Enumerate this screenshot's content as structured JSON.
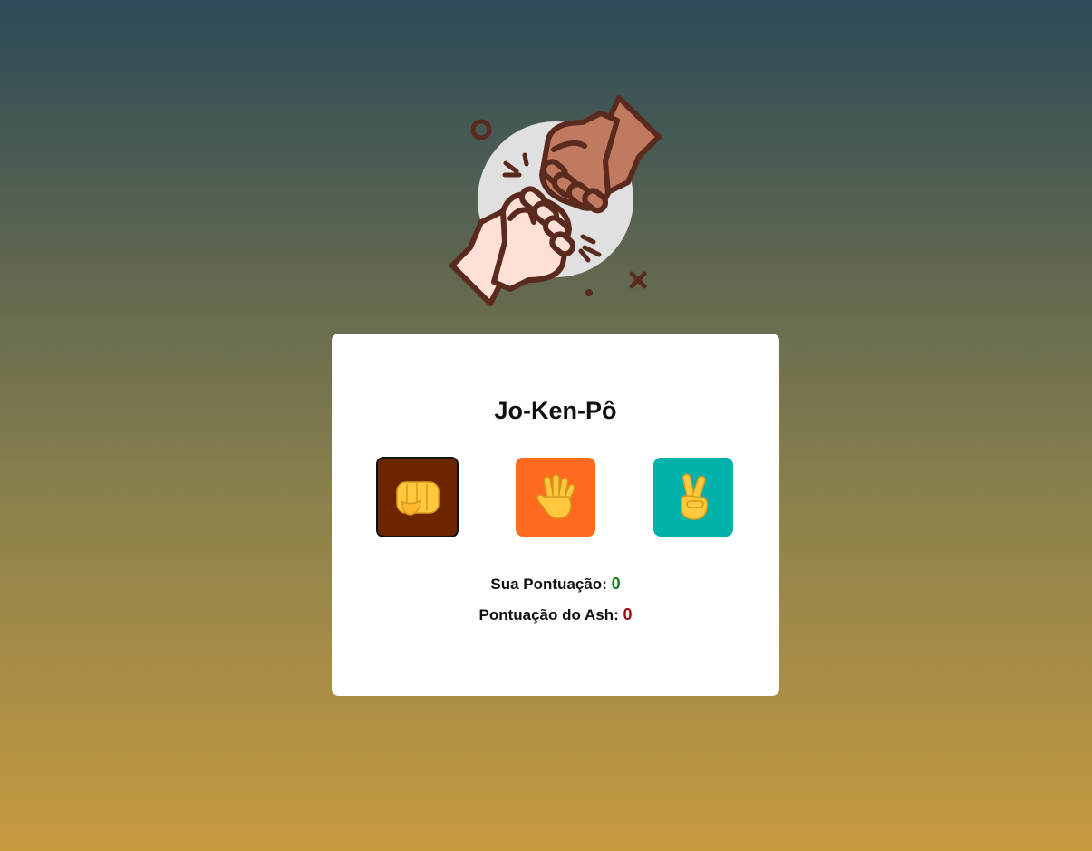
{
  "game": {
    "title": "Jo-Ken-Pô",
    "choices": [
      {
        "id": "rock",
        "icon": "fist-icon",
        "color": "#6b2600"
      },
      {
        "id": "paper",
        "icon": "open-hand-icon",
        "color": "#ff6a1f"
      },
      {
        "id": "scissors",
        "icon": "victory-hand-icon",
        "color": "#00b2a9"
      }
    ],
    "score": {
      "player_label": "Sua Pontuação:",
      "player_value": "0",
      "ash_label": "Pontuação do Ash:",
      "ash_value": "0"
    }
  },
  "logo": {
    "icon": "fist-bump-icon"
  }
}
